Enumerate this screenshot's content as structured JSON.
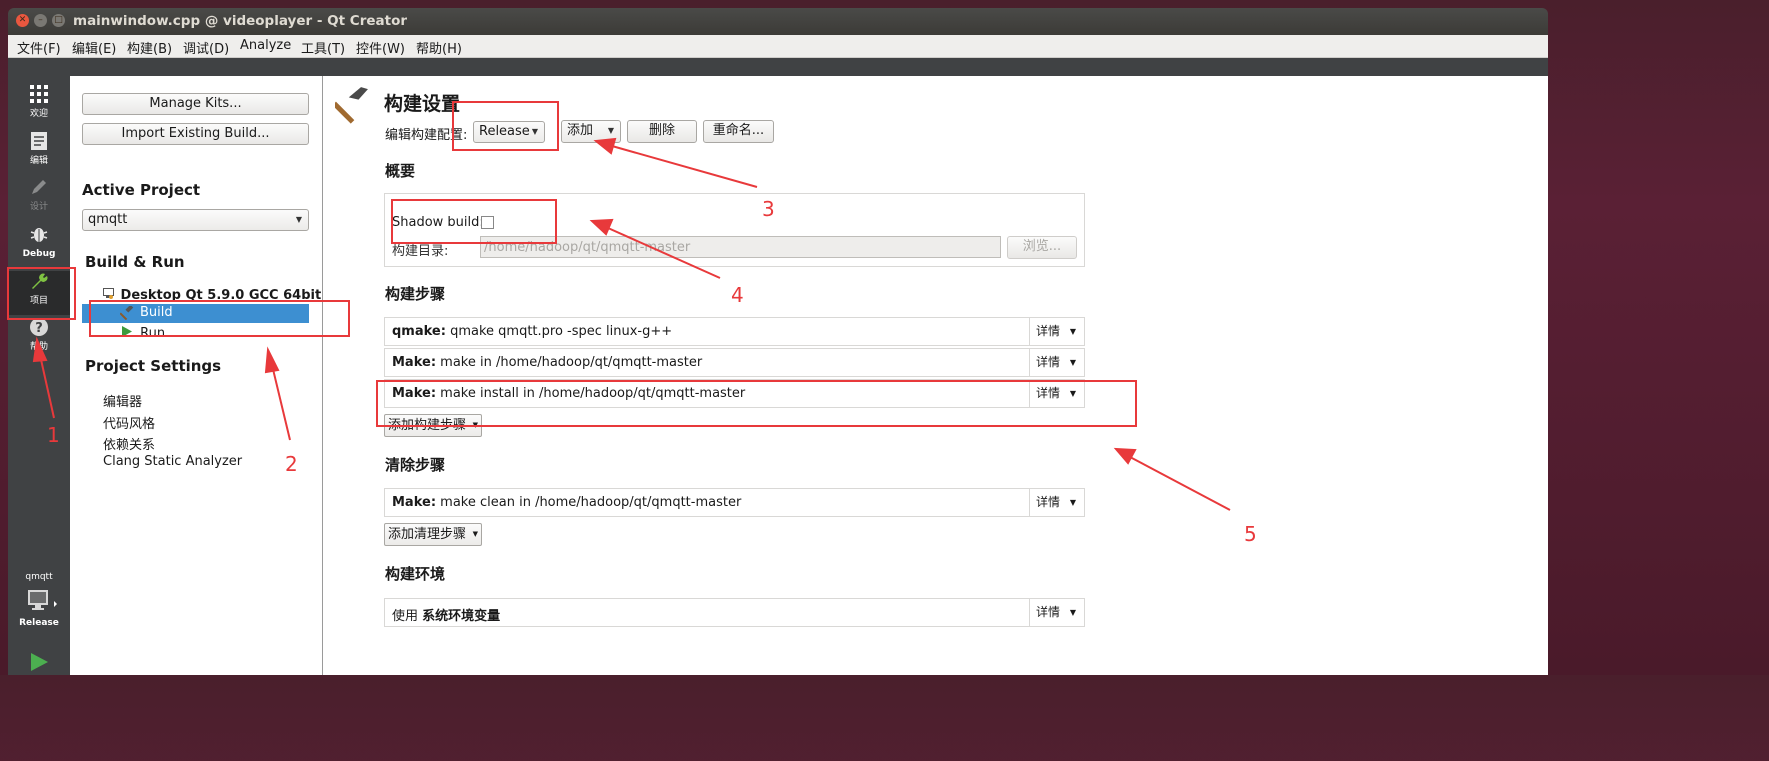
{
  "window": {
    "title": "mainwindow.cpp @ videoplayer - Qt Creator"
  },
  "menubar": {
    "items": [
      "文件(F)",
      "编辑(E)",
      "构建(B)",
      "调试(D)",
      "Analyze",
      "工具(T)",
      "控件(W)",
      "帮助(H)"
    ]
  },
  "modebar": {
    "items": [
      {
        "label": "欢迎",
        "icon": "grid-icon"
      },
      {
        "label": "编辑",
        "icon": "document-icon"
      },
      {
        "label": "设计",
        "icon": "pencil-icon"
      },
      {
        "label": "Debug",
        "icon": "bug-icon"
      },
      {
        "label": "项目",
        "icon": "wrench-icon"
      },
      {
        "label": "帮助",
        "icon": "help-icon"
      }
    ],
    "kit_project": "qmqtt",
    "kit_config": "Release"
  },
  "sidepanel": {
    "manage_kits": "Manage Kits...",
    "import_build": "Import Existing Build...",
    "active_project_title": "Active Project",
    "active_project_value": "qmqtt",
    "build_run_title": "Build & Run",
    "kit_name": "Desktop Qt 5.9.0 GCC 64bit",
    "build_label": "Build",
    "run_label": "Run",
    "project_settings_title": "Project Settings",
    "settings_items": [
      "编辑器",
      "代码风格",
      "依赖关系",
      "Clang Static Analyzer"
    ]
  },
  "main": {
    "heading": "构建设置",
    "edit_config_label": "编辑构建配置:",
    "config_value": "Release",
    "add_label": "添加",
    "delete_label": "删除",
    "rename_label": "重命名...",
    "overview_title": "概要",
    "shadow_build_label": "Shadow build:",
    "build_dir_label": "构建目录:",
    "build_dir_value": "/home/hadoop/qt/qmqtt-master",
    "browse_label": "浏览...",
    "build_steps_title": "构建步骤",
    "build_steps": [
      {
        "bold": "qmake:",
        "text": " qmake qmqtt.pro -spec linux-g++"
      },
      {
        "bold": "Make:",
        "text": " make in /home/hadoop/qt/qmqtt-master"
      },
      {
        "bold": "Make:",
        "text": " make install in /home/hadoop/qt/qmqtt-master"
      }
    ],
    "details_label": "详情",
    "add_build_step": "添加构建步骤",
    "clean_steps_title": "清除步骤",
    "clean_steps": [
      {
        "bold": "Make:",
        "text": " make clean in /home/hadoop/qt/qmqtt-master"
      }
    ],
    "add_clean_step": "添加清理步骤",
    "build_env_title": "构建环境",
    "env_prefix": "使用 ",
    "env_value": "系统环境变量"
  },
  "annotations": [
    "1",
    "2",
    "3",
    "4",
    "5"
  ],
  "colors": {
    "annotation": "#e8393b",
    "selection": "#3d8fd1",
    "modebar": "#404244"
  }
}
